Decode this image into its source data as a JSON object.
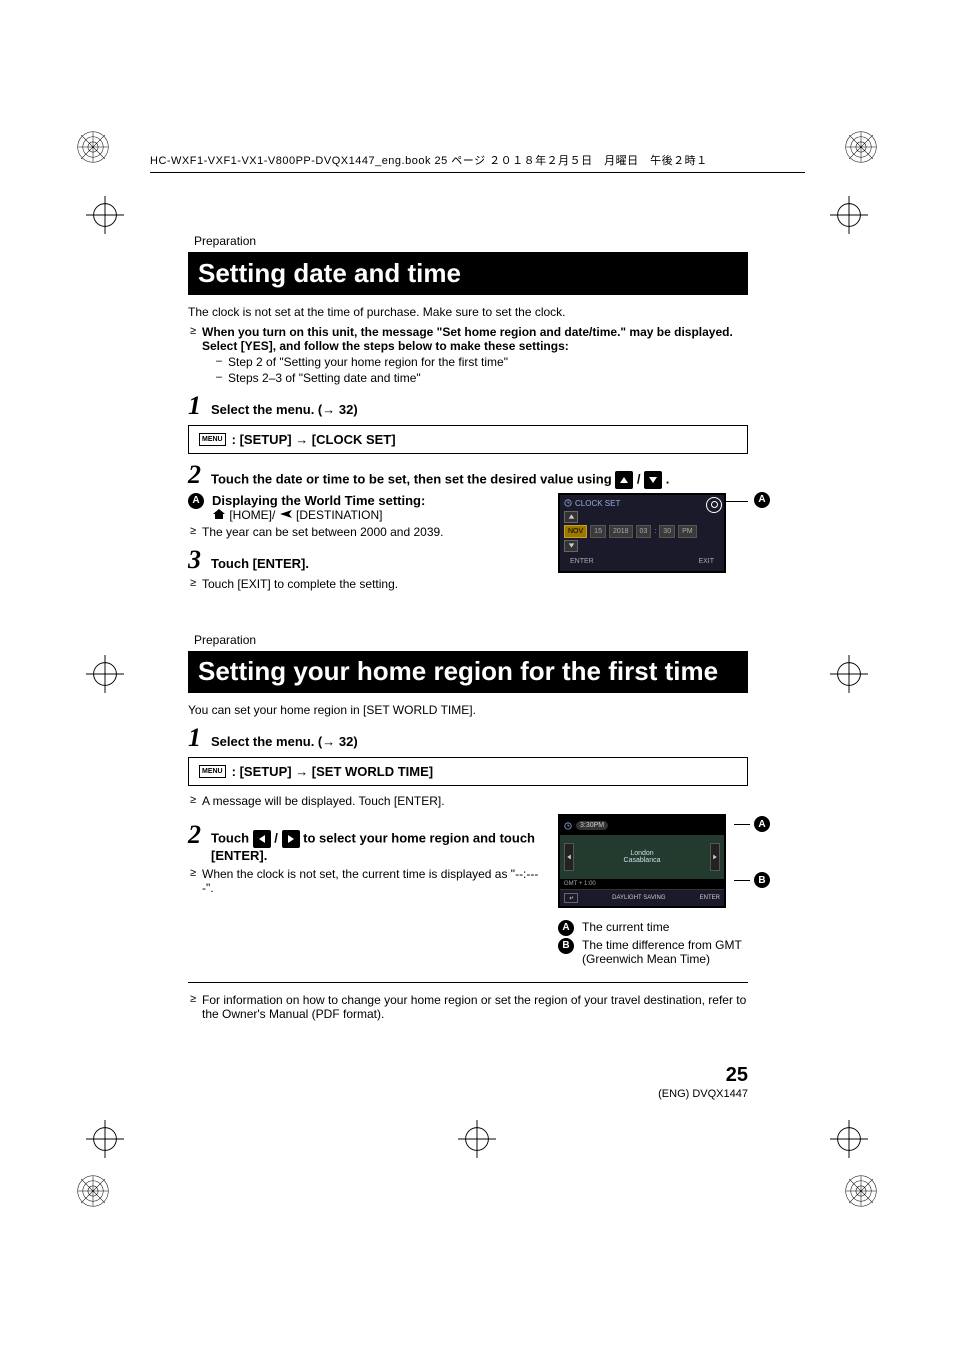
{
  "header": {
    "book_line": "HC-WXF1-VXF1-VX1-V800PP-DVQX1447_eng.book  25 ページ  ２０１８年２月５日　月曜日　午後２時１"
  },
  "section1": {
    "breadcrumb": "Preparation",
    "title": "Setting date and time",
    "intro": "The clock is not set at the time of purchase. Make sure to set the clock.",
    "bullet1_bold": "When you turn on this unit, the message \"Set home region and date/time.\" may be displayed. Select [YES], and follow the steps below to make these settings:",
    "sub1": "Step 2 of \"Setting your home region for the first time\"",
    "sub2": "Steps 2–3 of \"Setting date and time\"",
    "step1": "Select the menu. (",
    "step1_ref": " 32)",
    "menu_icon": "MENU",
    "menu_path_a": ": [SETUP] ",
    "menu_path_b": " [CLOCK SET]",
    "step2_a": "Touch the date or time to be set, then set the desired value using ",
    "step2_b": " / ",
    "step2_c": " .",
    "callout_a_label": "A",
    "callout_a_text": "Displaying the World Time setting:",
    "home_label": " [HOME]/ ",
    "dest_label": " [DESTINATION]",
    "year_note": "The year can be set between 2000 and 2039.",
    "step3": "Touch [ENTER].",
    "exit_note": "Touch [EXIT] to complete the setting.",
    "clock_screen": {
      "title": "CLOCK SET",
      "cells": [
        "NOV",
        "15",
        "2018",
        "03",
        ":",
        "30",
        "PM"
      ],
      "enter": "ENTER",
      "exit": "EXIT"
    }
  },
  "section2": {
    "breadcrumb": "Preparation",
    "title": "Setting your home region for the first time",
    "intro": "You can set your home region in [SET WORLD TIME].",
    "step1": "Select the menu. (",
    "step1_ref": " 32)",
    "menu_icon": "MENU",
    "menu_path_a": ": [SETUP] ",
    "menu_path_b": " [SET WORLD TIME]",
    "msg_note": "A message will be displayed. Touch [ENTER].",
    "step2_a": "Touch ",
    "step2_b": " / ",
    "step2_c": " to select your home region and touch [ENTER].",
    "clock_note": "When the clock is not set, the current time is displayed as \"--:----\".",
    "world_screen": {
      "time": "3:30PM",
      "city1": "London",
      "city2": "Casablanca",
      "gmt": "GMT   + 1:00",
      "daylight": "DAYLIGHT SAVING",
      "enter": "ENTER"
    },
    "legend_a": "The current time",
    "legend_b_1": "The time difference from GMT",
    "legend_b_2": "(Greenwich Mean Time)",
    "footer_note": "For information on how to change your home region or set the region of your travel destination, refer to the Owner's Manual (PDF format)."
  },
  "footer": {
    "page": "25",
    "code": "(ENG) DVQX1447"
  },
  "labels": {
    "A": "A",
    "B": "B"
  }
}
